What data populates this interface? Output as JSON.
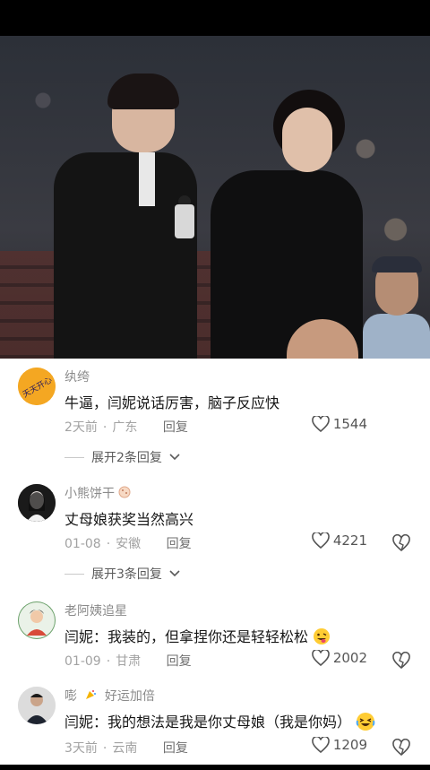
{
  "comments": [
    {
      "username": "纨绔",
      "text": "牛逼，闫妮说话厉害，脑子反应快",
      "time": "2天前",
      "location": "广东",
      "reply_label": "回复",
      "likes": "1544",
      "expand_label": "展开2条回复",
      "avatar_text": "天天开心"
    },
    {
      "username": "小熊饼干",
      "text": "丈母娘获奖当然高兴",
      "time": "01-08",
      "location": "安徽",
      "reply_label": "回复",
      "likes": "4221",
      "expand_label": "展开3条回复"
    },
    {
      "username": "老阿姨追星",
      "text": "闫妮：我装的，但拿捏你还是轻轻松松",
      "time": "01-09",
      "location": "甘肃",
      "reply_label": "回复",
      "likes": "2002"
    },
    {
      "username": "嘭",
      "username_tag": "好运加倍",
      "text": "闫妮：我的想法是我是你丈母娘（我是你妈）",
      "time": "3天前",
      "location": "云南",
      "reply_label": "回复",
      "likes": "1209"
    }
  ],
  "colors": {
    "accent_heart": "#555555",
    "text_primary": "#161616",
    "text_secondary": "#8a8a8a"
  },
  "icons": [
    "heart-icon",
    "dislike-icon",
    "chevron-down-icon",
    "tongue-emoji",
    "laughing-emoji",
    "party-icon",
    "cookie-icon"
  ]
}
